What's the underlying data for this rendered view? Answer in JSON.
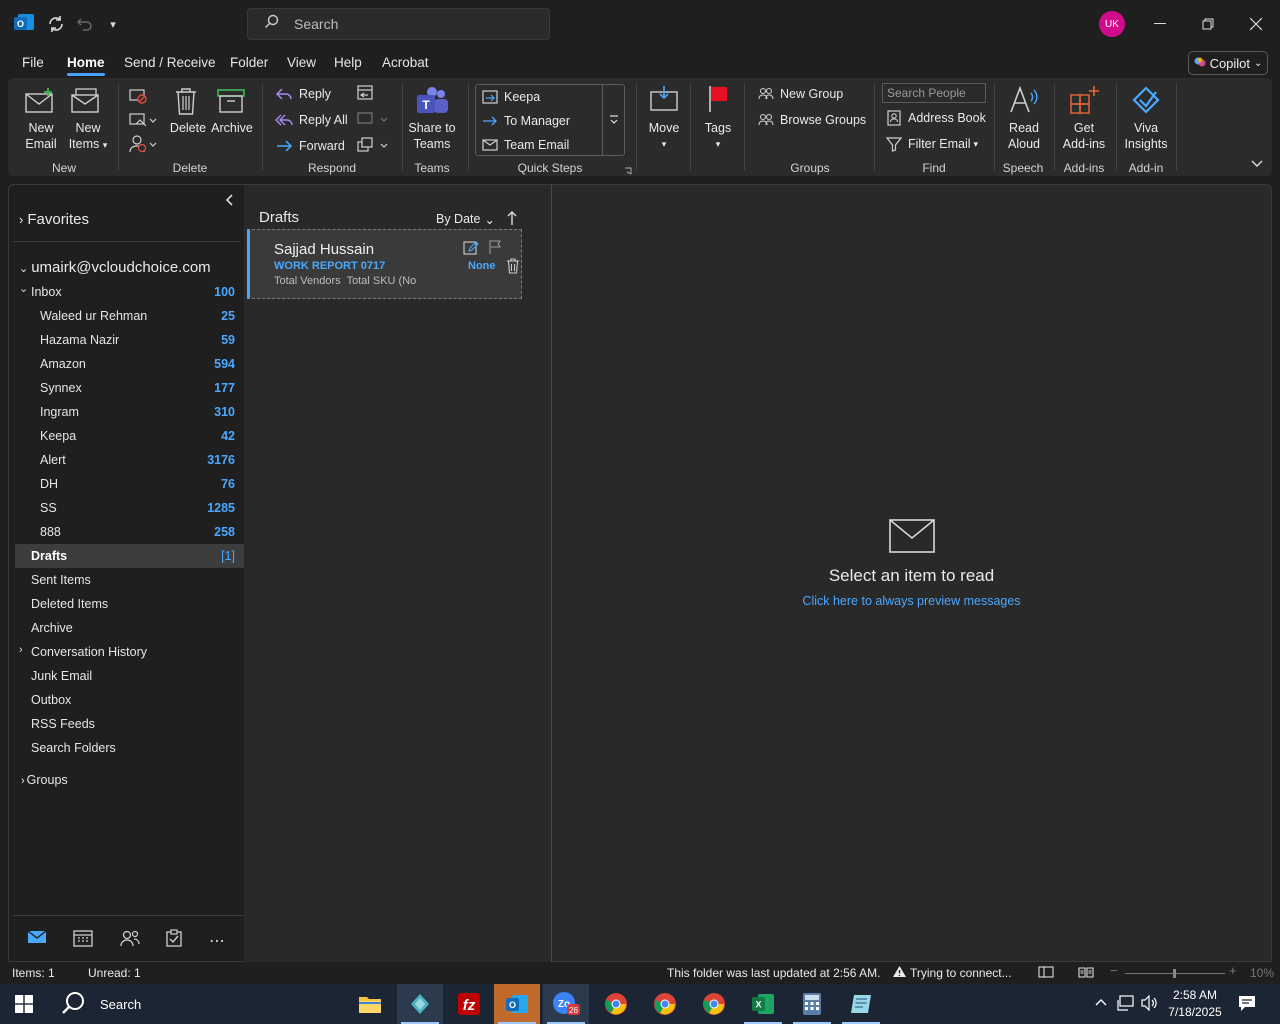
{
  "titlebar": {
    "search_placeholder": "Search",
    "avatar_initials": "UK"
  },
  "menu": {
    "items": [
      "File",
      "Home",
      "Send / Receive",
      "Folder",
      "View",
      "Help",
      "Acrobat"
    ],
    "active": "Home",
    "copilot": "Copilot"
  },
  "ribbon": {
    "new": {
      "new_email": [
        "New",
        "Email"
      ],
      "new_items": [
        "New",
        "Items"
      ],
      "group": "New"
    },
    "delete": {
      "delete": "Delete",
      "archive": "Archive",
      "group": "Delete"
    },
    "respond": {
      "reply": "Reply",
      "reply_all": "Reply All",
      "forward": "Forward",
      "group": "Respond"
    },
    "teams": {
      "share": [
        "Share to",
        "Teams"
      ],
      "group": "Teams"
    },
    "quick_steps": {
      "items": [
        "Keepa",
        "To Manager",
        "Team Email"
      ],
      "group": "Quick Steps"
    },
    "move": {
      "label": "Move"
    },
    "tags": {
      "label": "Tags"
    },
    "groups": {
      "new_group": "New Group",
      "browse_groups": "Browse Groups",
      "group": "Groups"
    },
    "find": {
      "search_people": "Search People",
      "address_book": "Address Book",
      "filter_email": "Filter Email",
      "group": "Find"
    },
    "speech": {
      "read_aloud": [
        "Read",
        "Aloud"
      ],
      "group": "Speech"
    },
    "addins": {
      "get_addins": [
        "Get",
        "Add-ins"
      ],
      "group": "Add-ins"
    },
    "addin": {
      "viva": [
        "Viva",
        "Insights"
      ],
      "group": "Add-in"
    }
  },
  "nav": {
    "favorites": "Favorites",
    "account": "umairk@vcloudchoice.com",
    "folders": [
      {
        "name": "Inbox",
        "count": "100",
        "indent": 1,
        "chevron": "open"
      },
      {
        "name": "Waleed ur Rehman",
        "count": "25",
        "indent": 2
      },
      {
        "name": "Hazama Nazir",
        "count": "59",
        "indent": 2
      },
      {
        "name": "Amazon",
        "count": "594",
        "indent": 2
      },
      {
        "name": "Synnex",
        "count": "177",
        "indent": 2
      },
      {
        "name": "Ingram",
        "count": "310",
        "indent": 2
      },
      {
        "name": "Keepa",
        "count": "42",
        "indent": 2
      },
      {
        "name": "Alert",
        "count": "3176",
        "indent": 2
      },
      {
        "name": "DH",
        "count": "76",
        "indent": 2
      },
      {
        "name": "SS",
        "count": "1285",
        "indent": 2
      },
      {
        "name": "888",
        "count": "258",
        "indent": 2
      },
      {
        "name": "Drafts",
        "count": "[1]",
        "indent": 1,
        "selected": true
      },
      {
        "name": "Sent Items",
        "count": "",
        "indent": 1
      },
      {
        "name": "Deleted Items",
        "count": "",
        "indent": 1
      },
      {
        "name": "Archive",
        "count": "",
        "indent": 1
      },
      {
        "name": "Conversation History",
        "count": "",
        "indent": 1,
        "chevron": "closed"
      },
      {
        "name": "Junk Email",
        "count": "",
        "indent": 1
      },
      {
        "name": "Outbox",
        "count": "",
        "indent": 1
      },
      {
        "name": "RSS Feeds",
        "count": "",
        "indent": 1
      },
      {
        "name": "Search Folders",
        "count": "",
        "indent": 1
      }
    ],
    "groups": "Groups"
  },
  "list": {
    "folder_title": "Drafts",
    "sort": "By Date",
    "message": {
      "sender": "Sajjad Hussain",
      "subject": "WORK REPORT 0717",
      "preview": "Total Vendors  Total SKU (No",
      "category": "None"
    }
  },
  "reading": {
    "empty_title": "Select an item to read",
    "preview_link": "Click here to always preview messages"
  },
  "status": {
    "items": "Items: 1",
    "unread": "Unread: 1",
    "updated": "This folder was last updated at 2:56 AM.",
    "connecting": "Trying to connect...",
    "zoom": "10%"
  },
  "taskbar": {
    "search": "Search",
    "time": "2:58 AM",
    "date": "7/18/2025",
    "badge": "26"
  },
  "colors": {
    "accent": "#4aa8ff",
    "avatar": "#d10b8c",
    "flag": "#e81123"
  }
}
